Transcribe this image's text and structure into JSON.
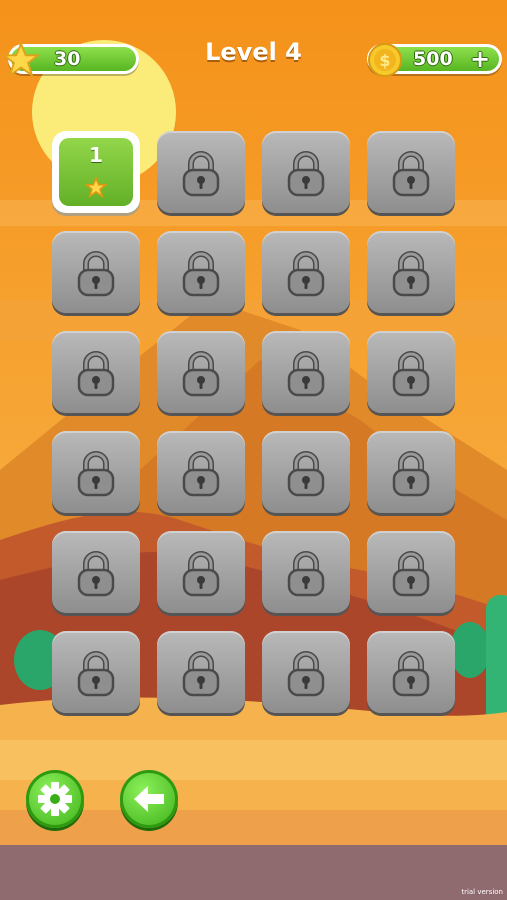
{
  "header": {
    "title": "Level 4",
    "stars_count": "30",
    "coins_count": "500",
    "add_symbol": "+"
  },
  "levels": [
    {
      "number": "1",
      "state": "unlocked",
      "stars": 1
    },
    {
      "state": "locked"
    },
    {
      "state": "locked"
    },
    {
      "state": "locked"
    },
    {
      "state": "locked"
    },
    {
      "state": "locked"
    },
    {
      "state": "locked"
    },
    {
      "state": "locked"
    },
    {
      "state": "locked"
    },
    {
      "state": "locked"
    },
    {
      "state": "locked"
    },
    {
      "state": "locked"
    },
    {
      "state": "locked"
    },
    {
      "state": "locked"
    },
    {
      "state": "locked"
    },
    {
      "state": "locked"
    },
    {
      "state": "locked"
    },
    {
      "state": "locked"
    },
    {
      "state": "locked"
    },
    {
      "state": "locked"
    },
    {
      "state": "locked"
    },
    {
      "state": "locked"
    },
    {
      "state": "locked"
    },
    {
      "state": "locked"
    }
  ],
  "icons": {
    "star": "star-icon",
    "coin": "coin-icon",
    "lock": "padlock-icon",
    "settings": "gear-icon",
    "back": "arrow-left-icon"
  },
  "footer": {
    "note": "trial version"
  },
  "colors": {
    "sky_top": "#f59a1c",
    "sky_bottom": "#f4b63c",
    "sun": "#fdf07a",
    "button_green": "#5cc322",
    "tile_gray": "#a3a3a3"
  }
}
